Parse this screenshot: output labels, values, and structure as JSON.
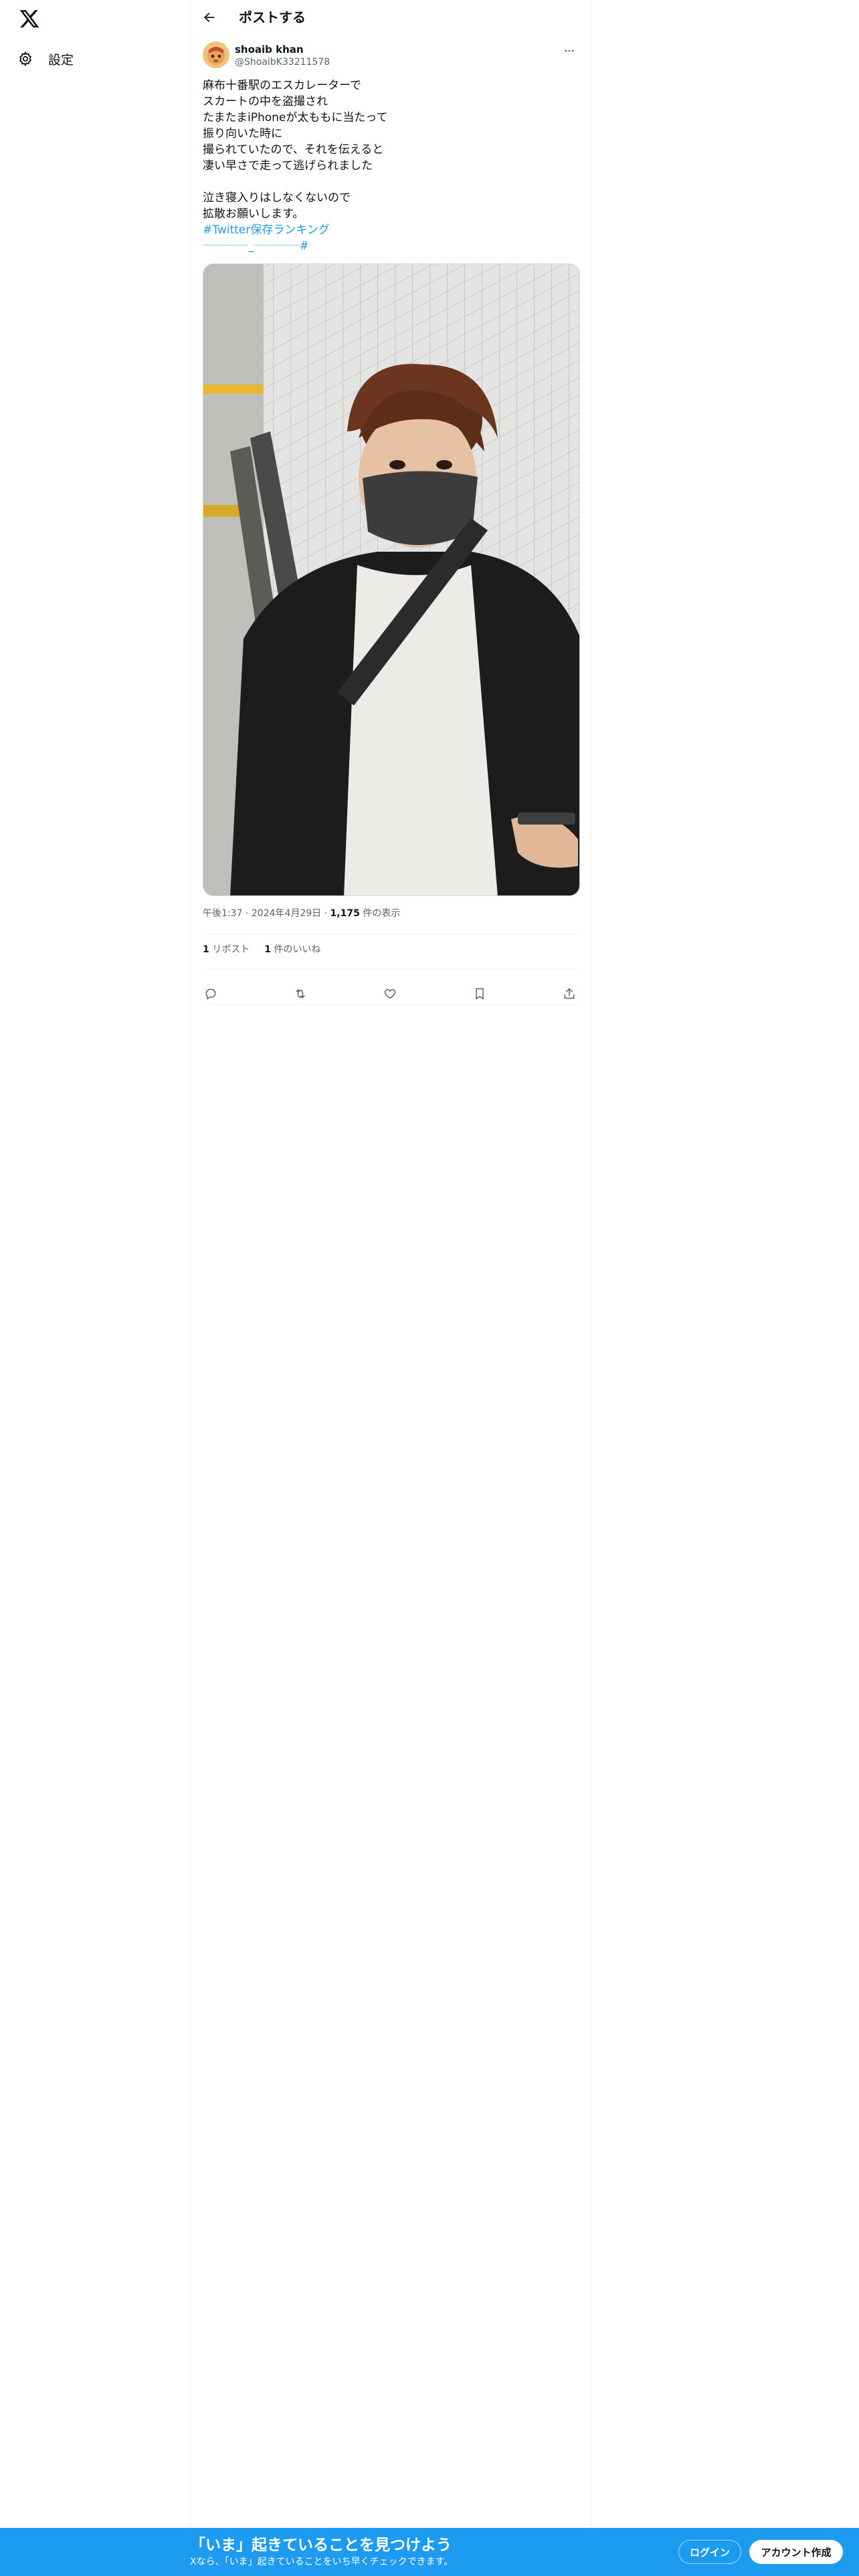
{
  "nav": {
    "logo": "x-logo",
    "settings_label": "設定"
  },
  "header": {
    "title": "ポストする"
  },
  "post": {
    "author_name": "shoaib khan",
    "author_handle": "@ShoaibK33211578",
    "text_lines_1": [
      "麻布十番駅のエスカレーターで",
      "スカートの中を盗撮され",
      "たまたまiPhoneが太ももに当たって",
      "振り向いた時に",
      "撮られていたので、それを伝えると",
      "凄い早さで走って逃げられました"
    ],
    "text_lines_2": [
      "泣き寝入りはしなくないので",
      "拡散お願いします。"
    ],
    "hashtag": "#Twitter保存ランキング",
    "hashtag_2": "𝄖𝄖𝄖𝄖𝄖_𝄖𝄖𝄖𝄖𝄖#",
    "time": "午後1:37",
    "date": "2024年4月29日",
    "sep": "·",
    "views_count": "1,175",
    "views_label": "件の表示",
    "reposts_count": "1",
    "reposts_label": "リポスト",
    "likes_count": "1",
    "likes_label": "件のいいね"
  },
  "bottom_bar": {
    "title": "「いま」起きていることを見つけよう",
    "subtitle": "Xなら、「いま」起きていることをいち早くチェックできます。",
    "login_label": "ログイン",
    "signup_label": "アカウント作成"
  },
  "colors": {
    "accent": "#1d9bf0",
    "text": "#0f1419",
    "muted": "#536471"
  }
}
